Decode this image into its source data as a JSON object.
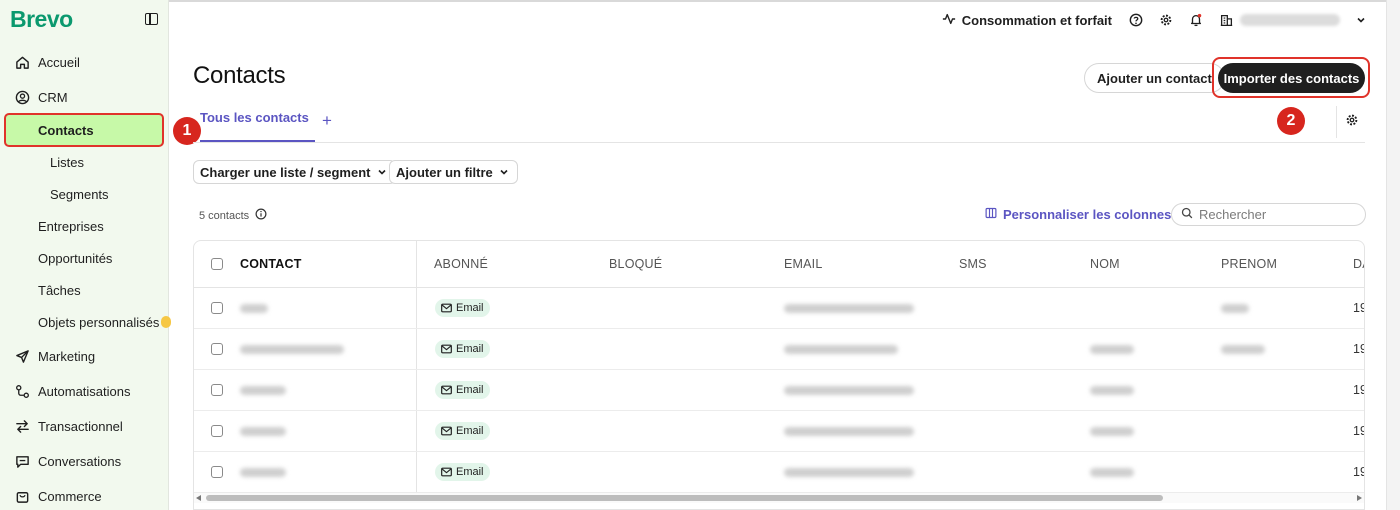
{
  "brand": {
    "logo": "Brevo",
    "accent": "#0b996e"
  },
  "sidebar": {
    "items": [
      {
        "label": "Accueil",
        "icon": "home-icon"
      },
      {
        "label": "CRM",
        "icon": "user-circle-icon"
      },
      {
        "label": "Contacts",
        "active": true
      },
      {
        "label": "Listes",
        "sub": true
      },
      {
        "label": "Segments",
        "sub": true
      },
      {
        "label": "Entreprises"
      },
      {
        "label": "Opportunités"
      },
      {
        "label": "Tâches"
      },
      {
        "label": "Objets personnalisés"
      },
      {
        "label": "Marketing",
        "icon": "send-icon"
      },
      {
        "label": "Automatisations",
        "icon": "automation-icon"
      },
      {
        "label": "Transactionnel",
        "icon": "swap-icon"
      },
      {
        "label": "Conversations",
        "icon": "chat-icon"
      },
      {
        "label": "Commerce",
        "icon": "bag-icon"
      }
    ]
  },
  "topbar": {
    "usage_label": "Consommation et forfait"
  },
  "header": {
    "title": "Contacts",
    "add_contact": "Ajouter un contact",
    "import_contacts": "Importer des contacts"
  },
  "steps": {
    "one": "1",
    "two": "2"
  },
  "tabs": {
    "active": "Tous les contacts",
    "add": "+"
  },
  "filters": {
    "load_list": "Charger une liste / segment",
    "add_filter": "Ajouter un filtre"
  },
  "toolbar": {
    "count": "5 contacts",
    "customize": "Personnaliser les colonnes",
    "search_placeholder": "Rechercher"
  },
  "table": {
    "columns": [
      "CONTACT",
      "ABONNÉ",
      "BLOQUÉ",
      "EMAIL",
      "SMS",
      "NOM",
      "PRENOM",
      "DA"
    ],
    "rows": [
      {
        "subscribed": "Email",
        "date": "19"
      },
      {
        "subscribed": "Email",
        "date": "19"
      },
      {
        "subscribed": "Email",
        "date": "19"
      },
      {
        "subscribed": "Email",
        "date": "19"
      },
      {
        "subscribed": "Email",
        "date": "19"
      }
    ]
  },
  "colors": {
    "accent_purple": "#5b55c2",
    "active_nav": "#c7f9a8",
    "highlight_red": "#e0332a"
  }
}
